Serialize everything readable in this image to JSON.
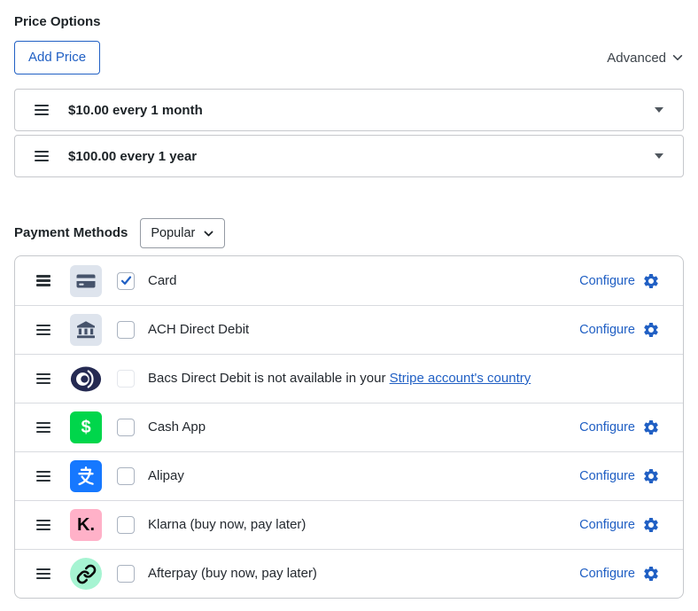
{
  "colors": {
    "accent": "#2160c4",
    "heading": "#1d2327",
    "row_border": "#c6c8cc",
    "cashapp_green": "#00d64b",
    "alipay_blue": "#1678ff",
    "klarna_pink": "#ffb1c8",
    "afterpay_mint": "#a6f4d2",
    "bacs_navy": "#252a52",
    "neutral_icon_bg": "#dee4ed",
    "neutral_icon_fg": "#46536b"
  },
  "price_options": {
    "title": "Price Options",
    "add_button_label": "Add Price",
    "advanced_label": "Advanced",
    "items": [
      {
        "label": "$10.00 every 1 month"
      },
      {
        "label": "$100.00 every 1 year"
      }
    ]
  },
  "payment_methods": {
    "title": "Payment Methods",
    "filter_label": "Popular",
    "configure_label": "Configure",
    "rows": [
      {
        "icon": "card-icon",
        "icon_kind": "card",
        "icon_bg": "#dee4ed",
        "label": "Card",
        "checked": true,
        "disabled": false,
        "configurable": true
      },
      {
        "icon": "bank-icon",
        "icon_kind": "bank",
        "icon_bg": "#dee4ed",
        "label": "ACH Direct Debit",
        "checked": false,
        "disabled": false,
        "configurable": true
      },
      {
        "icon": "bacs-icon",
        "icon_kind": "bacs",
        "icon_bg": "",
        "label": "Bacs Direct Debit is not available in your ",
        "link_text": "Stripe account's country",
        "checked": false,
        "disabled": true,
        "configurable": false
      },
      {
        "icon": "cashapp-icon",
        "icon_kind": "text",
        "icon_bg": "#00d64b",
        "icon_text": "$",
        "icon_text_color": "#ffffff",
        "label": "Cash App",
        "checked": false,
        "disabled": false,
        "configurable": true
      },
      {
        "icon": "alipay-icon",
        "icon_kind": "alipay",
        "icon_bg": "#1678ff",
        "label": "Alipay",
        "checked": false,
        "disabled": false,
        "configurable": true
      },
      {
        "icon": "klarna-icon",
        "icon_kind": "text",
        "icon_bg": "#ffb1c8",
        "icon_text": "K.",
        "icon_text_color": "#0a0a0a",
        "label": "Klarna (buy now, pay later)",
        "checked": false,
        "disabled": false,
        "configurable": true
      },
      {
        "icon": "afterpay-icon",
        "icon_kind": "afterpay",
        "icon_bg": "#a6f4d2",
        "icon_round": true,
        "label": "Afterpay (buy now, pay later)",
        "checked": false,
        "disabled": false,
        "configurable": true
      }
    ]
  }
}
